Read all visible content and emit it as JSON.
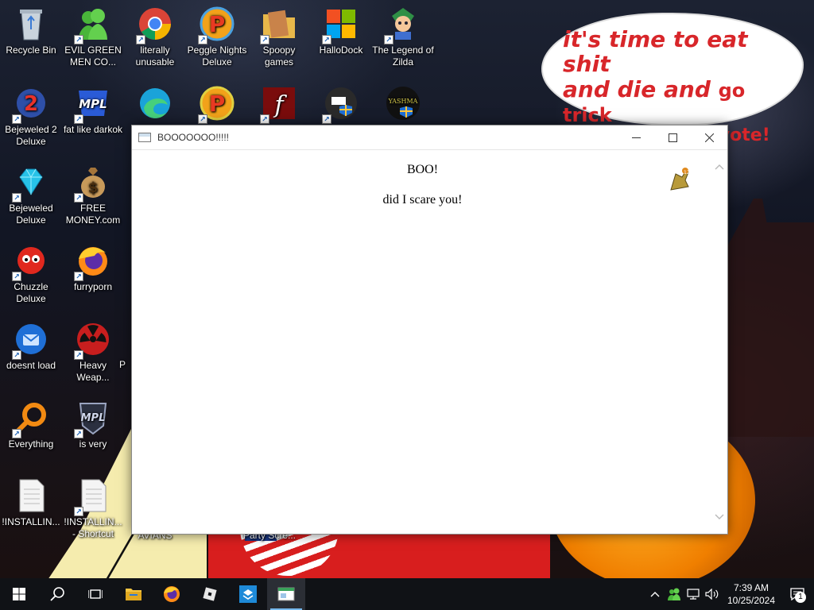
{
  "desktop": {
    "icons": [
      {
        "label": "Recycle Bin",
        "icon": "recycle-bin-icon"
      },
      {
        "label": "EVIL GREEN MEN CO...",
        "icon": "green-men-icon"
      },
      {
        "label": "literally unusable",
        "icon": "chrome-icon"
      },
      {
        "label": "Peggle Nights Deluxe",
        "icon": "peggle-icon"
      },
      {
        "label": "Spoopy games",
        "icon": "folder-icon"
      },
      {
        "label": "HalloDock",
        "icon": "windows-logo-icon"
      },
      {
        "label": "The Legend of Zilda",
        "icon": "zilda-icon"
      },
      {
        "label": "Bejeweled 2 Deluxe",
        "icon": "bejeweled2-icon"
      },
      {
        "label": "fat like darkok",
        "icon": "mpl-icon"
      },
      {
        "label": "Bejeweled Deluxe",
        "icon": "diamond-icon"
      },
      {
        "label": "FREE MONEY.com",
        "icon": "money-bag-icon"
      },
      {
        "label": "Chuzzle Deluxe",
        "icon": "chuzzle-icon"
      },
      {
        "label": "furryporn",
        "icon": "firefox-icon"
      },
      {
        "label": "doesnt load",
        "icon": "thunderbird-icon"
      },
      {
        "label": "Heavy Weap...",
        "icon": "radiation-icon"
      },
      {
        "label": "Everything",
        "icon": "search-magnifier-icon"
      },
      {
        "label": "is very",
        "icon": "mpl-shield-icon"
      },
      {
        "label": "!INSTALLIN...",
        "icon": "text-file-icon"
      },
      {
        "label": "!INSTALLIN... - Shortcut",
        "icon": "text-file-icon"
      }
    ],
    "partial_labels": [
      "P",
      "AVIANS",
      "Party Scre..."
    ],
    "speech_bubble": {
      "line1": "it's time to eat shit",
      "line2a": "and die and",
      "line2b": "go trick",
      "line3": "or treating and vote!"
    }
  },
  "window": {
    "title": "BOOOOOOO!!!!!",
    "minimize_glyph": "—",
    "maximize_glyph": "☐",
    "close_glyph": "✕",
    "content": {
      "heading": "BOO!",
      "message": "did I scare you!"
    }
  },
  "taskbar": {
    "items": [
      {
        "name": "start-button",
        "icon": "windows-start-icon"
      },
      {
        "name": "search-button",
        "icon": "search-icon"
      },
      {
        "name": "task-view-button",
        "icon": "task-view-icon"
      },
      {
        "name": "file-explorer",
        "icon": "folder-icon"
      },
      {
        "name": "firefox",
        "icon": "firefox-icon"
      },
      {
        "name": "roblox",
        "icon": "roblox-icon"
      },
      {
        "name": "app-blue",
        "icon": "app-icon"
      },
      {
        "name": "boo-window",
        "icon": "window-icon"
      }
    ],
    "clock": {
      "time": "7:39 AM",
      "date": "10/25/2024"
    },
    "notification_count": "1"
  },
  "colors": {
    "taskbar": "#101216",
    "bubble_text": "#d8262a",
    "accent": "#76b9ed"
  }
}
